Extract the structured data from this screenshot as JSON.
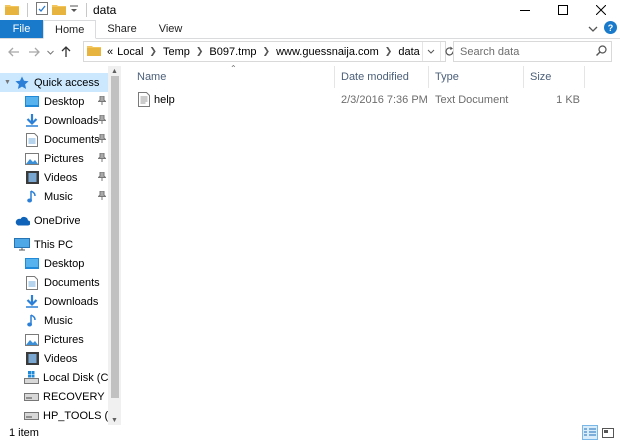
{
  "window": {
    "title": "data"
  },
  "ribbon": {
    "tabs": [
      {
        "label": "File"
      },
      {
        "label": "Home"
      },
      {
        "label": "Share"
      },
      {
        "label": "View"
      }
    ]
  },
  "address": {
    "overflow": "«",
    "crumbs": [
      "Local",
      "Temp",
      "B097.tmp",
      "www.guessnaija.com",
      "data"
    ]
  },
  "search": {
    "placeholder": "Search data"
  },
  "nav": {
    "quick_access": "Quick access",
    "quick_items": [
      "Desktop",
      "Downloads",
      "Documents",
      "Pictures",
      "Videos",
      "Music"
    ],
    "onedrive": "OneDrive",
    "this_pc": "This PC",
    "pc_items": [
      "Desktop",
      "Documents",
      "Downloads",
      "Music",
      "Pictures",
      "Videos",
      "Local Disk (C:)",
      "RECOVERY (E:)",
      "HP_TOOLS (F:)"
    ]
  },
  "columns": {
    "name": "Name",
    "date": "Date modified",
    "type": "Type",
    "size": "Size"
  },
  "files": [
    {
      "name": "help",
      "date": "2/3/2016 7:36 PM",
      "type": "Text Document",
      "size": "1 KB"
    }
  ],
  "status": {
    "count": "1 item"
  },
  "colors": {
    "accent": "#1979ca",
    "selection": "#cce8ff",
    "folder": "#f3c55b"
  }
}
